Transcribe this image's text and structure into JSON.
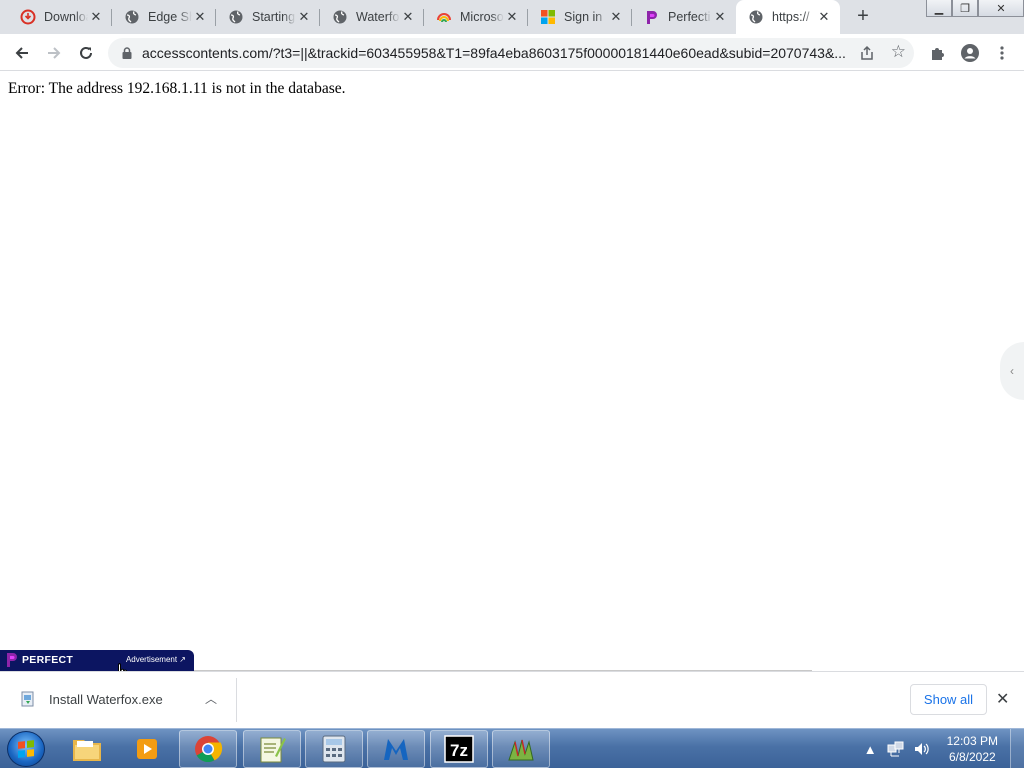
{
  "browser": {
    "tabs": [
      {
        "title": "Downloads",
        "icon": "downloads-icon"
      },
      {
        "title": "Edge Sh",
        "icon": "globe-icon"
      },
      {
        "title": "Starting",
        "icon": "globe-icon"
      },
      {
        "title": "Waterfo",
        "icon": "globe-icon"
      },
      {
        "title": "Microso",
        "icon": "microsoft-edge-icon"
      },
      {
        "title": "Sign in",
        "icon": "microsoft-logo-icon"
      },
      {
        "title": "Perfecti",
        "icon": "perfect-logo-icon"
      },
      {
        "title": "https://",
        "icon": "globe-icon"
      }
    ],
    "active_tab_index": 7,
    "url": "accesscontents.com/?t3=||&trackid=603455958&T1=89fa4eba8603175f00000181440e60ead&subid=2070743&..."
  },
  "page": {
    "error_message": "Error: The address 192.168.1.11 is not in the database."
  },
  "ad": {
    "brand": "PERFECT",
    "label": "Advertisement ↗"
  },
  "downloads": {
    "file_name": "Install Waterfox.exe",
    "show_all_label": "Show all"
  },
  "taskbar": {
    "apps": [
      "windows-explorer",
      "media-player",
      "google-chrome",
      "notepad-plus",
      "calculator",
      "malwarebytes",
      "7-zip",
      "winrar"
    ],
    "time": "12:03 PM",
    "date": "6/8/2022"
  },
  "colors": {
    "tab_strip": "#dee1e6",
    "ad_bar": "#0c1561",
    "link_blue": "#1a73e8"
  }
}
